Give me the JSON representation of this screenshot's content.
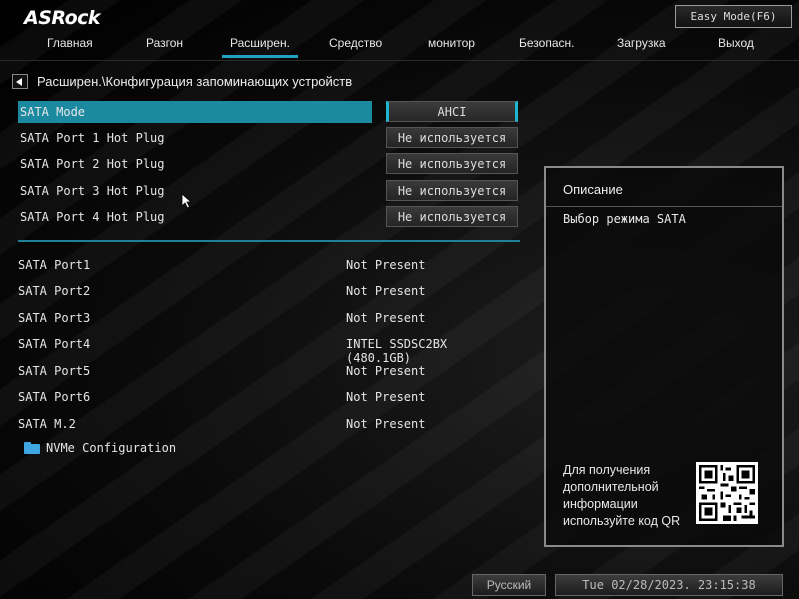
{
  "header": {
    "logo": "ASRock",
    "easy_mode_label": "Easy Mode(F6)"
  },
  "nav": {
    "tabs": [
      {
        "label": "Главная"
      },
      {
        "label": "Разгон"
      },
      {
        "label": "Расширен."
      },
      {
        "label": "Средство"
      },
      {
        "label": "монитор"
      },
      {
        "label": "Безопасн."
      },
      {
        "label": "Загрузка"
      },
      {
        "label": "Выход"
      }
    ],
    "active_index": 2
  },
  "breadcrumb": "Расширен.\\Конфигурация запоминающих устройств",
  "options": [
    {
      "label": "SATA Mode",
      "value": "AHCI",
      "selected": true
    },
    {
      "label": "SATA Port 1 Hot Plug",
      "value": "Не используется"
    },
    {
      "label": "SATA Port 2 Hot Plug",
      "value": "Не используется"
    },
    {
      "label": "SATA Port 3 Hot Plug",
      "value": "Не используется"
    },
    {
      "label": "SATA Port 4 Hot Plug",
      "value": "Не используется"
    }
  ],
  "ports": [
    {
      "label": "SATA Port1",
      "value": "Not Present"
    },
    {
      "label": "SATA Port2",
      "value": "Not Present"
    },
    {
      "label": "SATA Port3",
      "value": "Not Present"
    },
    {
      "label": "SATA Port4",
      "value": "INTEL SSDSC2BX (480.1GB)"
    },
    {
      "label": "SATA Port5",
      "value": "Not Present"
    },
    {
      "label": "SATA Port6",
      "value": "Not Present"
    },
    {
      "label": "SATA M.2",
      "value": "Not Present"
    }
  ],
  "nvme": {
    "label": "NVMe Configuration"
  },
  "description": {
    "title": "Описание",
    "text": "Выбор режима SATA",
    "help": "Для получения дополнительной информации используйте код QR"
  },
  "footer": {
    "language": "Русский",
    "datetime": "Tue 02/28/2023. 23:15:38"
  },
  "colors": {
    "accent": "#1b8aa0",
    "background": "#000000"
  }
}
